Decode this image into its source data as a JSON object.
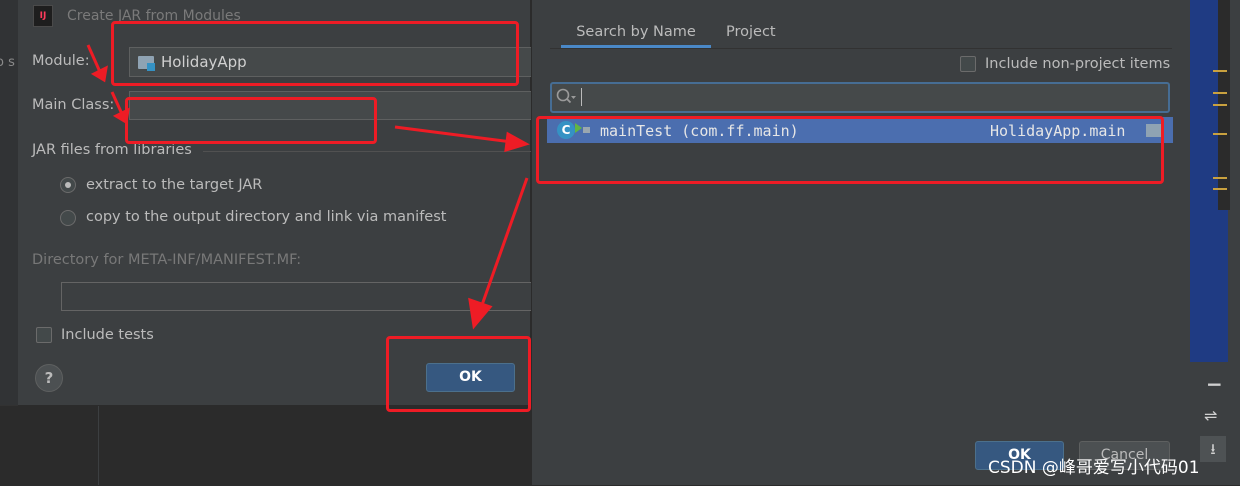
{
  "background": {
    "peek_text": "o s"
  },
  "jar_dialog": {
    "title": "Create JAR from Modules",
    "title_icon_text": "IJ",
    "module_label": "Module:",
    "module_value": "HolidayApp",
    "main_class_label": "Main Class:",
    "main_class_value": "",
    "jar_files_label": "JAR files from libraries",
    "radio_extract_label": "extract to the target JAR",
    "radio_copy_label": "copy to the output directory and link via manifest",
    "radio_selected": "extract",
    "manifest_dir_label": "Directory for META-INF/MANIFEST.MF:",
    "manifest_dir_value": "",
    "include_tests_label": "Include tests",
    "include_tests_checked": false,
    "help_label": "?",
    "ok_label": "OK"
  },
  "class_chooser": {
    "tabs": [
      {
        "label": "Search by Name",
        "active": true
      },
      {
        "label": "Project",
        "active": false
      }
    ],
    "include_non_project_label": "Include non-project items",
    "include_non_project_checked": false,
    "search_value": "",
    "results": [
      {
        "name": "mainTest (com.ff.main)",
        "module": "HolidayApp.main",
        "selected": true
      }
    ],
    "ok_label": "OK",
    "cancel_label": "Cancel"
  },
  "ide_right": {
    "minus": "−",
    "wrap": "⇌",
    "scroll_down": "⭳"
  },
  "watermark": "CSDN @峰哥爱写小代码01",
  "colors": {
    "annotation_red": "#ee1c25",
    "accent_blue": "#4b6eaf",
    "ok_button": "#365880"
  }
}
